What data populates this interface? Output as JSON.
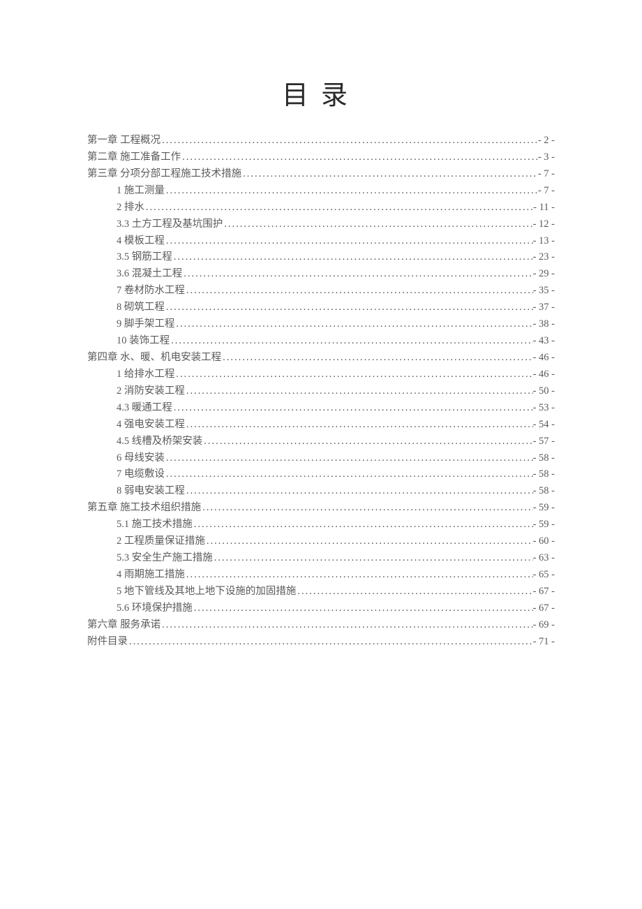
{
  "title": "目录",
  "entries": [
    {
      "level": 1,
      "label": "第一章 工程概况",
      "page": "- 2 -"
    },
    {
      "level": 1,
      "label": "第二章 施工准备工作",
      "page": "- 3 -"
    },
    {
      "level": 1,
      "label": "第三章 分项分部工程施工技术措施",
      "page": "- 7 -"
    },
    {
      "level": 2,
      "label": "1 施工测量",
      "page": "- 7 -"
    },
    {
      "level": 2,
      "label": "2 排水",
      "page": "- 11 -"
    },
    {
      "level": 2,
      "label": "3.3 土方工程及基坑围护",
      "page": "- 12 -"
    },
    {
      "level": 2,
      "label": "4 模板工程",
      "page": "- 13 -"
    },
    {
      "level": 2,
      "label": "3.5 钢筋工程",
      "page": "- 23 -"
    },
    {
      "level": 2,
      "label": "3.6 混凝土工程",
      "page": "- 29 -"
    },
    {
      "level": 2,
      "label": "7 卷材防水工程",
      "page": "- 35 -"
    },
    {
      "level": 2,
      "label": "8 砌筑工程",
      "page": "- 37 -"
    },
    {
      "level": 2,
      "label": "9 脚手架工程",
      "page": "- 38 -"
    },
    {
      "level": 2,
      "label": "10 装饰工程",
      "page": "- 43 -"
    },
    {
      "level": 1,
      "label": "第四章 水、暖、机电安装工程",
      "page": "- 46 -"
    },
    {
      "level": 2,
      "label": "1 给排水工程",
      "page": "- 46 -"
    },
    {
      "level": 2,
      "label": "2 消防安装工程",
      "page": "- 50 -"
    },
    {
      "level": 2,
      "label": "4.3 暖通工程",
      "page": "- 53 -"
    },
    {
      "level": 2,
      "label": "4 强电安装工程",
      "page": "- 54 -"
    },
    {
      "level": 2,
      "label": "4.5 线槽及桥架安装",
      "page": "- 57 -"
    },
    {
      "level": 2,
      "label": "6 母线安装",
      "page": "- 58 -"
    },
    {
      "level": 2,
      "label": "7 电缆敷设",
      "page": "- 58 -"
    },
    {
      "level": 2,
      "label": "8 弱电安装工程",
      "page": "- 58 -"
    },
    {
      "level": 1,
      "label": "第五章 施工技术组织措施",
      "page": "- 59 -"
    },
    {
      "level": 2,
      "label": "5.1 施工技术措施",
      "page": "- 59 -"
    },
    {
      "level": 2,
      "label": "2 工程质量保证措施",
      "page": "- 60 -"
    },
    {
      "level": 2,
      "label": "5.3 安全生产施工措施",
      "page": "- 63 -"
    },
    {
      "level": 2,
      "label": "4 雨期施工措施",
      "page": "- 65 -"
    },
    {
      "level": 2,
      "label": "5 地下管线及其地上地下设施的加固措施",
      "page": "- 67 -"
    },
    {
      "level": 2,
      "label": "5.6 环境保护措施",
      "page": "- 67 -"
    },
    {
      "level": 1,
      "label": "第六章 服务承诺",
      "page": "- 69 -"
    },
    {
      "level": 1,
      "label": "附件目录",
      "page": "- 71 -"
    }
  ]
}
